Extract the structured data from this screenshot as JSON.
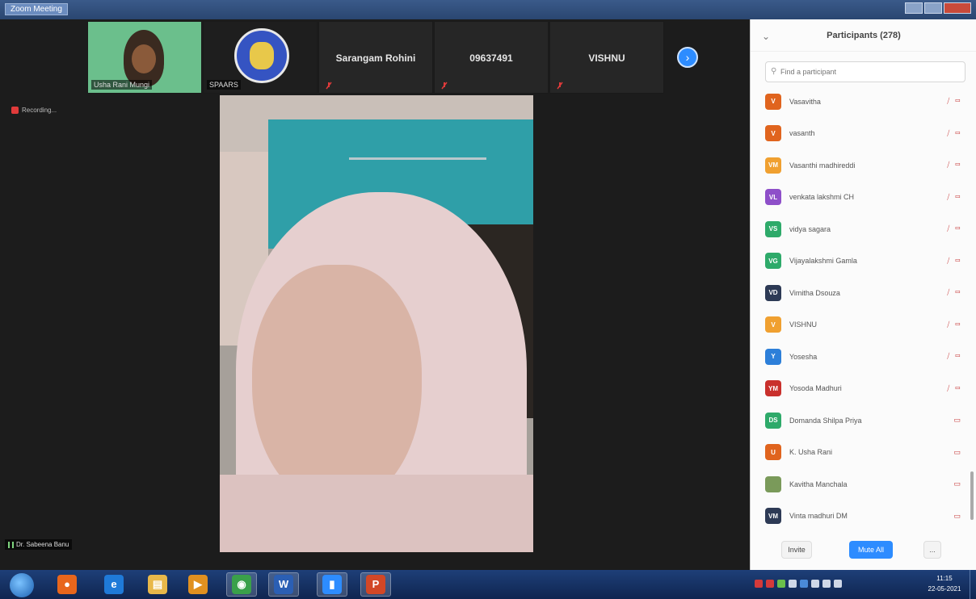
{
  "window": {
    "title": "Zoom Meeting"
  },
  "thumbnails": [
    {
      "kind": "video",
      "name": "Usha Rani Mungi"
    },
    {
      "kind": "logo",
      "name": "SPAARS"
    },
    {
      "kind": "name",
      "name": "Sarangam Rohini"
    },
    {
      "kind": "name",
      "name": "09637491"
    },
    {
      "kind": "name",
      "name": "VISHNU"
    }
  ],
  "recording": {
    "label": "Recording..."
  },
  "speaker": {
    "name": "Dr. Sabeena Banu"
  },
  "panel": {
    "title": "Participants (278)",
    "search_placeholder": "Find a participant",
    "participants": [
      {
        "initials": "V",
        "name": "Vasavitha",
        "color": "#e0641e",
        "icons": "⧸ ▭"
      },
      {
        "initials": "V",
        "name": "vasanth",
        "color": "#e0641e",
        "icons": "⧸ ▭"
      },
      {
        "initials": "VM",
        "name": "Vasanthi madhireddi",
        "color": "#f0a030",
        "icons": "⧸ ▭"
      },
      {
        "initials": "VL",
        "name": "venkata lakshmi CH",
        "color": "#8e4fc9",
        "icons": "⧸ ▭"
      },
      {
        "initials": "VS",
        "name": "vidya sagara",
        "color": "#2eaa6a",
        "icons": "⧸ ▭"
      },
      {
        "initials": "VG",
        "name": "Vijayalakshmi Gamla",
        "color": "#2eaa6a",
        "icons": "⧸ ▭"
      },
      {
        "initials": "VD",
        "name": "Vimitha Dsouza",
        "color": "#2d3a55",
        "icons": "⧸ ▭"
      },
      {
        "initials": "V",
        "name": "VISHNU",
        "color": "#f0a030",
        "icons": "⧸ ▭"
      },
      {
        "initials": "Y",
        "name": "Yosesha",
        "color": "#2d7fd9",
        "icons": "⧸ ▭"
      },
      {
        "initials": "YM",
        "name": "Yosoda Madhuri",
        "color": "#c9302c",
        "icons": "⧸ ▭"
      },
      {
        "initials": "DS",
        "name": "Domanda Shilpa Priya",
        "color": "#2eaa6a",
        "icons": "▭"
      },
      {
        "initials": "U",
        "name": "K. Usha Rani",
        "color": "#e0641e",
        "icons": "▭"
      },
      {
        "initials": "",
        "name": "Kavitha Manchala",
        "color": "#7a9a5a",
        "icons": "▭"
      },
      {
        "initials": "VM",
        "name": "Vinta madhuri DM",
        "color": "#2d3a55",
        "icons": "▭"
      }
    ],
    "invite_label": "Invite",
    "mute_all_label": "Mute All",
    "more_label": "..."
  },
  "taskbar": {
    "apps": [
      {
        "icon": "firefox-icon",
        "glyph": "●",
        "color": "#e8661c"
      },
      {
        "icon": "ie-icon",
        "glyph": "e",
        "color": "#1f7ad8"
      },
      {
        "icon": "explorer-icon",
        "glyph": "▤",
        "color": "#e8b84a"
      },
      {
        "icon": "media-icon",
        "glyph": "▶",
        "color": "#e09020"
      },
      {
        "icon": "chrome-icon",
        "glyph": "◉",
        "color": "#3aa04a"
      },
      {
        "icon": "word-icon",
        "glyph": "W",
        "color": "#2b5fb4"
      },
      {
        "icon": "zoom-icon",
        "glyph": "▮",
        "color": "#2d8cff"
      },
      {
        "icon": "powerpoint-icon",
        "glyph": "P",
        "color": "#d24726"
      }
    ],
    "time": "11:15",
    "date": "22-05-2021"
  }
}
